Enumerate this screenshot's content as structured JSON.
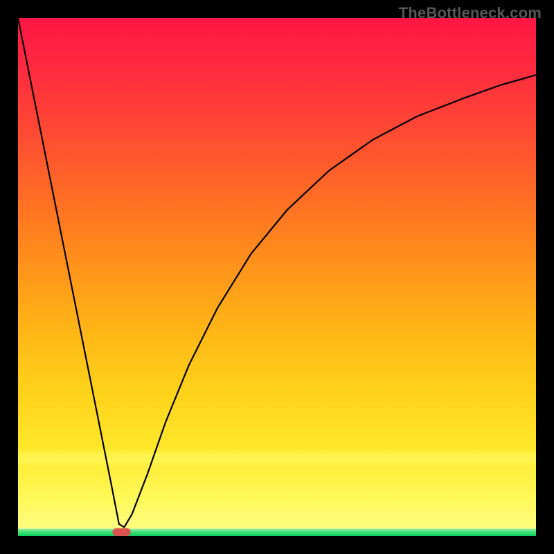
{
  "watermark": "TheBottleneck.com",
  "chart_data": {
    "type": "line",
    "title": "",
    "xlabel": "",
    "ylabel": "",
    "xlim": [
      0,
      100
    ],
    "ylim": [
      0,
      100
    ],
    "grid": false,
    "legend": false,
    "notes": "Bottleneck curve: V-shaped black line with left near-linear descent from top-left to a minimum near x≈20, then a rising curve approaching y≈89 at right edge. Thin yellow band sits near the bottom; green floor below it. Small red rounded marker at the curve minimum on the baseline.",
    "series": [
      {
        "name": "bottleneck-curve",
        "x": [
          0.0,
          4.5,
          9.0,
          13.5,
          18.0,
          19.5,
          20.5,
          22.0,
          25.0,
          28.5,
          33.0,
          38.5,
          45.0,
          52.0,
          60.0,
          68.5,
          77.0,
          86.0,
          93.0,
          100.0
        ],
        "y": [
          100.0,
          77.5,
          55.0,
          32.5,
          10.0,
          2.3,
          1.7,
          4.2,
          12.0,
          22.0,
          33.0,
          44.0,
          54.5,
          63.0,
          70.5,
          76.5,
          81.0,
          84.5,
          87.0,
          89.0
        ]
      }
    ],
    "marker": {
      "x": 20.0,
      "y": 0.0,
      "width": 3.5,
      "height": 1.5
    },
    "bands": {
      "yellow": {
        "y0": 13.0,
        "y1": 17.0
      },
      "green": {
        "y0": 0.0,
        "y1": 1.4
      }
    },
    "border_inset": 26
  }
}
